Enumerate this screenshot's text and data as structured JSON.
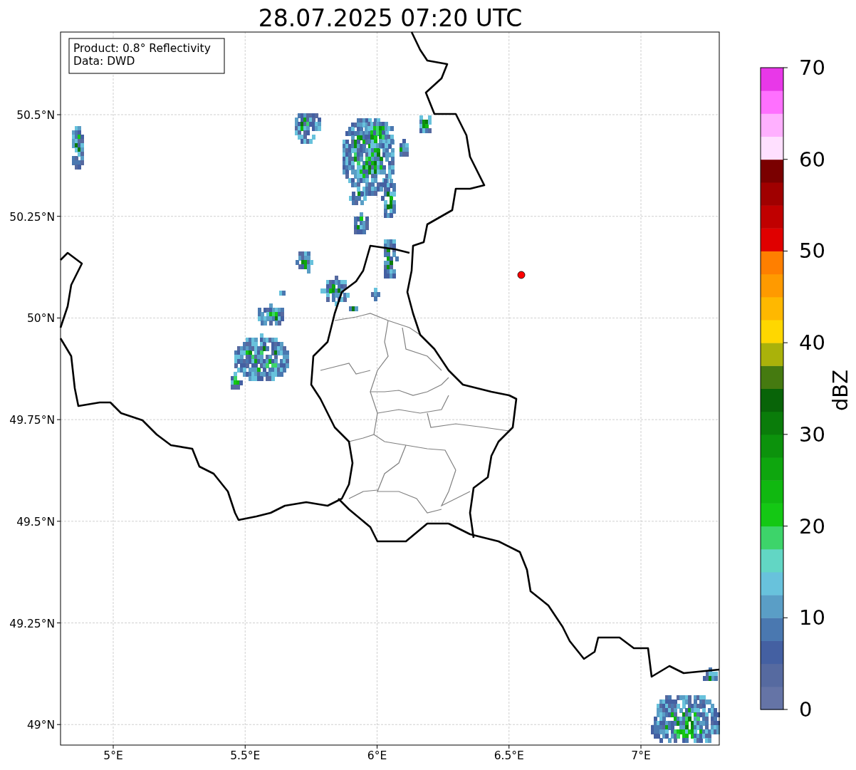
{
  "title": "28.07.2025 07:20 UTC",
  "info_box": [
    "Product: 0.8° Reflectivity",
    "Data: DWD"
  ],
  "map": {
    "xticks": [
      "5°E",
      "5.5°E",
      "6°E",
      "6.5°E",
      "7°E"
    ],
    "yticks": [
      "50.5°N",
      "50.25°N",
      "50°N",
      "49.75°N",
      "49.5°N",
      "49.25°N",
      "49°N"
    ],
    "marker": {
      "kind": "dot",
      "color": "#ff0000"
    }
  },
  "colorbar": {
    "label": "dBZ",
    "ticks": [
      "70",
      "60",
      "50",
      "40",
      "30",
      "20",
      "10",
      "0"
    ],
    "bins": [
      {
        "color": "#6574a6"
      },
      {
        "color": "#566aa0"
      },
      {
        "color": "#4460a2"
      },
      {
        "color": "#4a78b0"
      },
      {
        "color": "#5a9ec6"
      },
      {
        "color": "#68c2dc"
      },
      {
        "color": "#62d6c4"
      },
      {
        "color": "#3dd46a"
      },
      {
        "color": "#14c814"
      },
      {
        "color": "#10b810"
      },
      {
        "color": "#0ea60e"
      },
      {
        "color": "#0c920c"
      },
      {
        "color": "#0a7c0a"
      },
      {
        "color": "#086408"
      },
      {
        "color": "#457a10"
      },
      {
        "color": "#aab20a"
      },
      {
        "color": "#ffd700"
      },
      {
        "color": "#ffb800"
      },
      {
        "color": "#ff9a00"
      },
      {
        "color": "#ff7f00"
      },
      {
        "color": "#e00000"
      },
      {
        "color": "#c00000"
      },
      {
        "color": "#a00000"
      },
      {
        "color": "#7a0000"
      },
      {
        "color": "#ffe0ff"
      },
      {
        "color": "#ffb0ff"
      },
      {
        "color": "#ff70ff"
      },
      {
        "color": "#e838e8"
      }
    ]
  }
}
